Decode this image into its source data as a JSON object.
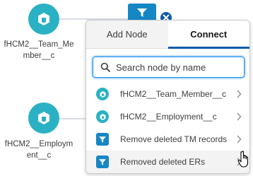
{
  "canvas": {
    "nodes": [
      {
        "label": "fHCM2__Team_Member__c",
        "icon": "object-icon"
      },
      {
        "label": "fHCM2__Employment__c",
        "icon": "object-icon"
      }
    ],
    "top_node_icon": "filter-icon",
    "close_icon": "close-icon"
  },
  "popover": {
    "tabs": [
      {
        "label": "Add Node",
        "active": false
      },
      {
        "label": "Connect",
        "active": true
      }
    ],
    "search": {
      "placeholder": "Search node by name",
      "icon": "search-icon"
    },
    "items": [
      {
        "label": "fHCM2__Team_Member__c",
        "icon": "object-icon"
      },
      {
        "label": "fHCM2__Employment__c",
        "icon": "object-icon"
      },
      {
        "label": "Remove deleted TM records",
        "icon": "filter-icon"
      },
      {
        "label": "Removed deleted ERs",
        "icon": "filter-icon",
        "hovered": true
      }
    ]
  },
  "colors": {
    "object_teal": "#2bb1c4",
    "filter_blue": "#1587c5",
    "accent": "#0b5cab",
    "focus_border": "#1b96ff"
  }
}
